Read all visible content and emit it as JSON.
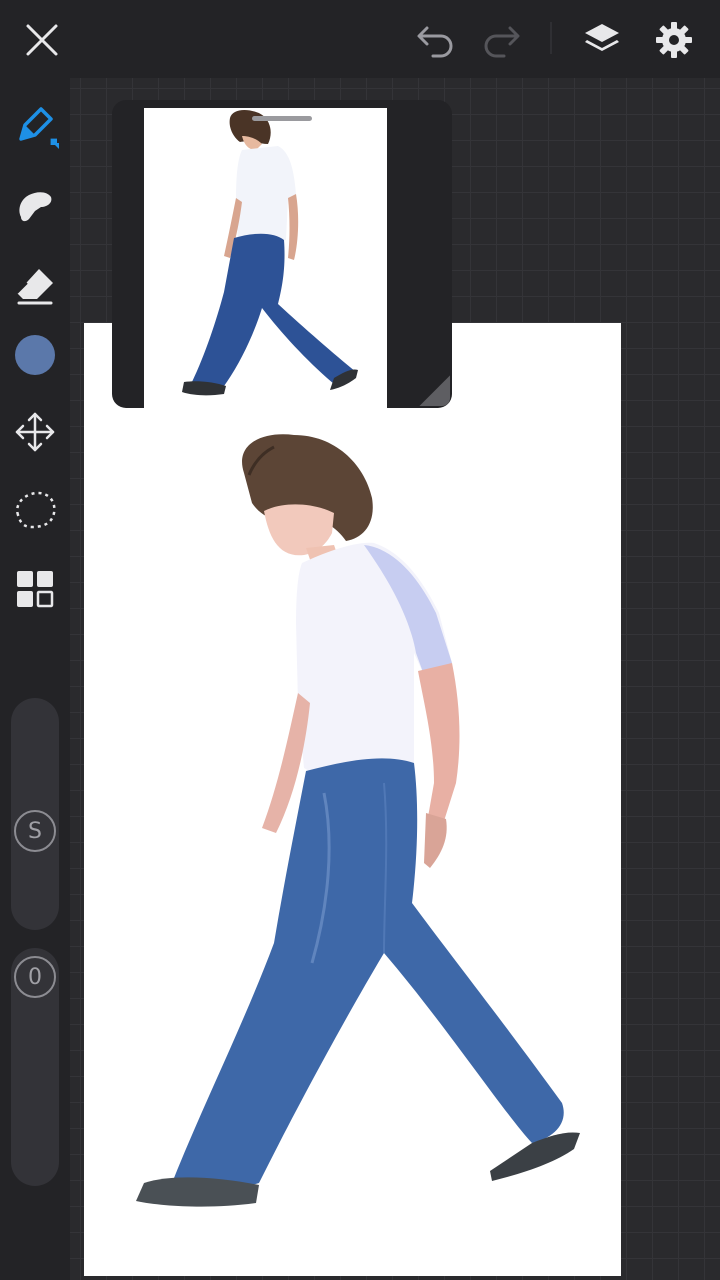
{
  "top_bar": {
    "close_icon": "close-icon",
    "undo_icon": "undo-arrow-icon",
    "redo_icon": "redo-arrow-icon",
    "layers_icon": "layers-icon",
    "settings_icon": "gear-icon"
  },
  "tools": [
    {
      "name": "brush",
      "icon": "brush-pen-icon",
      "active": true
    },
    {
      "name": "smudge",
      "icon": "smudge-finger-icon"
    },
    {
      "name": "eraser",
      "icon": "eraser-icon"
    },
    {
      "name": "color",
      "icon": "color-swatch",
      "color": "#5b78aa"
    },
    {
      "name": "transform",
      "icon": "move-arrows-icon"
    },
    {
      "name": "selection",
      "icon": "lasso-selection-icon"
    },
    {
      "name": "gallery",
      "icon": "grid-tiles-icon"
    }
  ],
  "sliders": {
    "size_label": "S",
    "opacity_label": "0"
  },
  "colors": {
    "accent": "#1e90e6",
    "background": "#232326",
    "canvas": "#ffffff",
    "current_color": "#5b78aa"
  },
  "reference": {
    "handle_icon": "drag-handle",
    "resize_icon": "resize-corner-icon"
  }
}
